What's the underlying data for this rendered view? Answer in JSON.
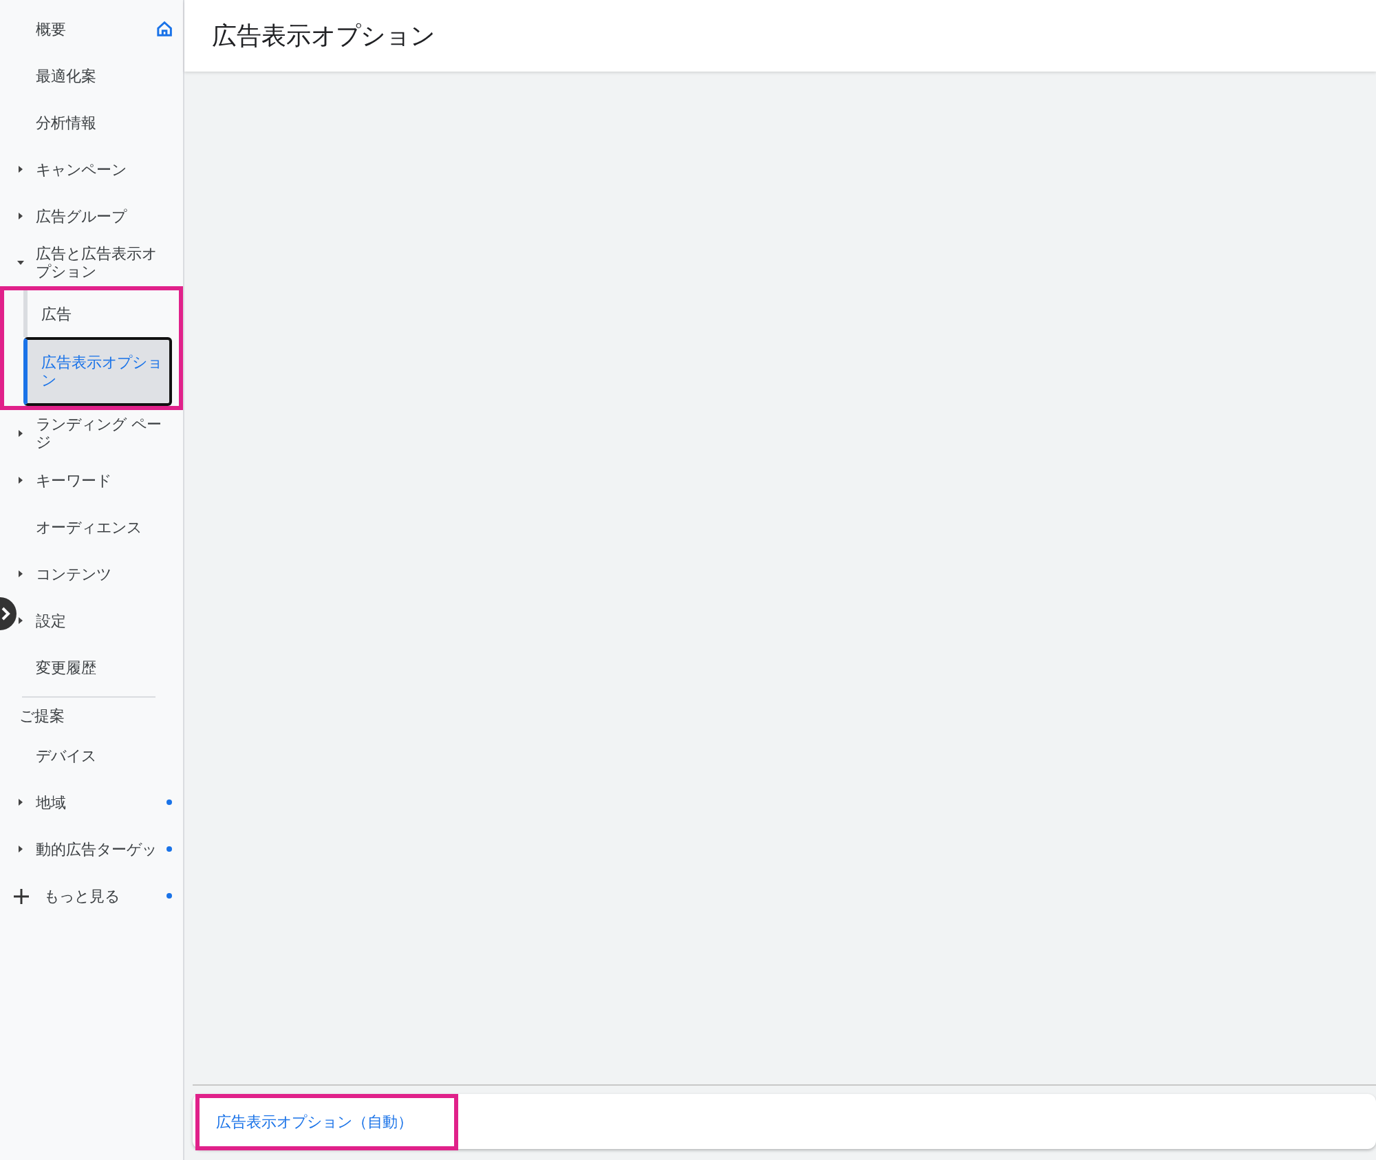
{
  "sidebar": {
    "items": [
      {
        "kind": "plain",
        "label": "概要",
        "home": true
      },
      {
        "kind": "plain",
        "label": "最適化案"
      },
      {
        "kind": "plain",
        "label": "分析情報"
      },
      {
        "kind": "expandable",
        "label": "キャンペーン",
        "expanded": false
      },
      {
        "kind": "expandable",
        "label": "広告グループ",
        "expanded": false
      },
      {
        "kind": "expandable",
        "label": "広告と広告表示オプション",
        "expanded": true,
        "highlighted": true,
        "children": [
          {
            "label": "広告",
            "selected": false
          },
          {
            "label": "広告表示オプション",
            "selected": true
          }
        ]
      },
      {
        "kind": "expandable",
        "label": "ランディング ページ",
        "expanded": false
      },
      {
        "kind": "expandable",
        "label": "キーワード",
        "expanded": false
      },
      {
        "kind": "plain",
        "label": "オーディエンス"
      },
      {
        "kind": "expandable",
        "label": "コンテンツ",
        "expanded": false
      },
      {
        "kind": "expandable",
        "label": "設定",
        "expanded": false
      },
      {
        "kind": "plain",
        "label": "変更履歴"
      },
      {
        "kind": "divider"
      },
      {
        "kind": "section",
        "label": "ご提案"
      },
      {
        "kind": "plain",
        "label": "デバイス"
      },
      {
        "kind": "expandable",
        "label": "地域",
        "expanded": false,
        "dot": true
      },
      {
        "kind": "expandable",
        "label": "動的広告ターゲッ",
        "expanded": false,
        "dot": true
      },
      {
        "kind": "more",
        "label": "もっと見る",
        "dot": true
      }
    ]
  },
  "page_title": "広告表示オプション",
  "footer_card": {
    "link": "広告表示オプション（自動）",
    "highlighted": true
  }
}
